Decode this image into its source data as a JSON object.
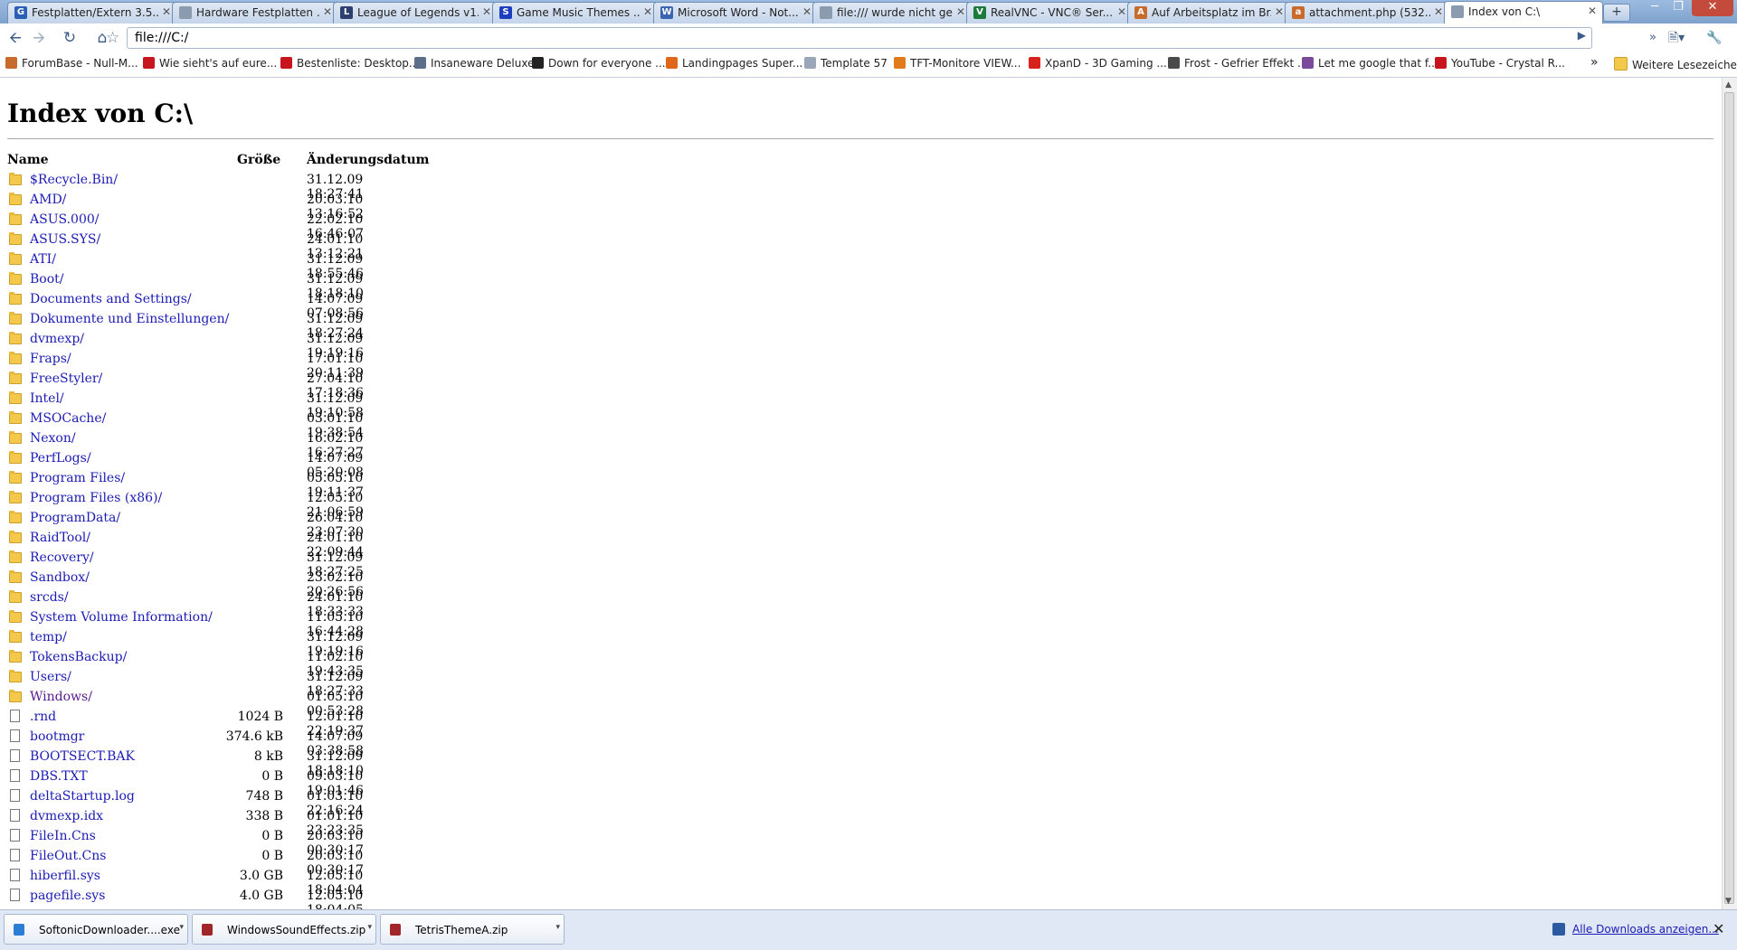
{
  "browser": {
    "tabs": [
      {
        "title": "Festplatten/Extern 3.5...",
        "icon": "g-icon",
        "color": "#2b5fb3",
        "glyph": "G"
      },
      {
        "title": "Hardware Festplatten ...",
        "icon": "page-icon",
        "color": "#8a9bb0",
        "glyph": ""
      },
      {
        "title": "League of Legends v1...",
        "icon": "lol-icon",
        "color": "#2c3f6e",
        "glyph": "L"
      },
      {
        "title": "Game Music Themes ...",
        "icon": "sonic-icon",
        "color": "#1c3fbf",
        "glyph": "S"
      },
      {
        "title": "Microsoft Word - Not...",
        "icon": "doc-icon",
        "color": "#3a64b0",
        "glyph": "W"
      },
      {
        "title": "file:/// wurde nicht ge...",
        "icon": "page-icon",
        "color": "#8a9bb0",
        "glyph": ""
      },
      {
        "title": "RealVNC - VNC® Ser...",
        "icon": "vnc-icon",
        "color": "#1d7a3a",
        "glyph": "V"
      },
      {
        "title": "Auf Arbeitsplatz im Br...",
        "icon": "forum-icon",
        "color": "#c86a2c",
        "glyph": "A"
      },
      {
        "title": "attachment.php (532...",
        "icon": "forum-icon",
        "color": "#c86a2c",
        "glyph": "a"
      },
      {
        "title": "Index von C:\\",
        "icon": "page-icon",
        "color": "#8a9bb0",
        "glyph": "",
        "active": true
      }
    ],
    "new_tab_label": "+",
    "url": "file:///C:/",
    "bookmarks": [
      {
        "label": "ForumBase - Null-M...",
        "icon": "forumbase-icon",
        "color": "#c86a2c"
      },
      {
        "label": "Wie sieht's auf eure...",
        "icon": "bookmark-red-icon",
        "color": "#c8141c"
      },
      {
        "label": "Bestenliste: Desktop...",
        "icon": "bookmark-red-icon",
        "color": "#c8141c"
      },
      {
        "label": "Insaneware Deluxe",
        "icon": "insaneware-icon",
        "color": "#5b6f8a"
      },
      {
        "label": "Down for everyone ...",
        "icon": "down-icon",
        "color": "#222222"
      },
      {
        "label": "Landingpages Super...",
        "icon": "landing-icon",
        "color": "#e0661a"
      },
      {
        "label": "Template 57",
        "icon": "page-icon",
        "color": "#9aa7b8"
      },
      {
        "label": "TFT-Monitore VIEW...",
        "icon": "tft-icon",
        "color": "#e07a1a"
      },
      {
        "label": "XpanD - 3D Gaming ...",
        "icon": "xpand-icon",
        "color": "#d8201c"
      },
      {
        "label": "Frost - Gefrier Effekt ...",
        "icon": "frost-icon",
        "color": "#4a4a4a"
      },
      {
        "label": "Let me google that f...",
        "icon": "lmgtfy-icon",
        "color": "#7b4a9a"
      },
      {
        "label": "YouTube - Crystal R...",
        "icon": "youtube-icon",
        "color": "#c8141c"
      }
    ],
    "bookmarks_overflow": "»",
    "other_bookmarks": "Weitere Lesezeichen"
  },
  "page": {
    "title": "Index von C:\\",
    "columns": {
      "name": "Name",
      "size": "Größe",
      "date": "Änderungsdatum"
    },
    "entries": [
      {
        "name": "$Recycle.Bin/",
        "size": "",
        "date": "31.12.09 18:27:41",
        "type": "folder"
      },
      {
        "name": "AMD/",
        "size": "",
        "date": "20.03.10 13:16:52",
        "type": "folder"
      },
      {
        "name": "ASUS.000/",
        "size": "",
        "date": "22.02.10 16:46:07",
        "type": "folder"
      },
      {
        "name": "ASUS.SYS/",
        "size": "",
        "date": "24.01.10 13:12:21",
        "type": "folder"
      },
      {
        "name": "ATI/",
        "size": "",
        "date": "31.12.09 18:55:46",
        "type": "folder"
      },
      {
        "name": "Boot/",
        "size": "",
        "date": "31.12.09 18:18:10",
        "type": "folder"
      },
      {
        "name": "Documents and Settings/",
        "size": "",
        "date": "14.07.09 07:08:56",
        "type": "folder"
      },
      {
        "name": "Dokumente und Einstellungen/",
        "size": "",
        "date": "31.12.09 18:27:24",
        "type": "folder"
      },
      {
        "name": "dvmexp/",
        "size": "",
        "date": "31.12.09 19:19:16",
        "type": "folder"
      },
      {
        "name": "Fraps/",
        "size": "",
        "date": "17.01.10 20:11:39",
        "type": "folder"
      },
      {
        "name": "FreeStyler/",
        "size": "",
        "date": "27.04.10 17:18:36",
        "type": "folder"
      },
      {
        "name": "Intel/",
        "size": "",
        "date": "31.12.09 19:10:58",
        "type": "folder"
      },
      {
        "name": "MSOCache/",
        "size": "",
        "date": "03.01.10 19:38:54",
        "type": "folder"
      },
      {
        "name": "Nexon/",
        "size": "",
        "date": "16.02.10 16:27:27",
        "type": "folder"
      },
      {
        "name": "PerfLogs/",
        "size": "",
        "date": "14.07.09 05:20:08",
        "type": "folder"
      },
      {
        "name": "Program Files/",
        "size": "",
        "date": "05.05.10 19:11:37",
        "type": "folder"
      },
      {
        "name": "Program Files (x86)/",
        "size": "",
        "date": "12.05.10 21:06:59",
        "type": "folder"
      },
      {
        "name": "ProgramData/",
        "size": "",
        "date": "26.04.10 23:07:30",
        "type": "folder"
      },
      {
        "name": "RaidTool/",
        "size": "",
        "date": "24.01.10 22:09:44",
        "type": "folder"
      },
      {
        "name": "Recovery/",
        "size": "",
        "date": "31.12.09 18:27:25",
        "type": "folder"
      },
      {
        "name": "Sandbox/",
        "size": "",
        "date": "23.02.10 20:26:56",
        "type": "folder"
      },
      {
        "name": "srcds/",
        "size": "",
        "date": "24.01.10 18:33:33",
        "type": "folder"
      },
      {
        "name": "System Volume Information/",
        "size": "",
        "date": "11.05.10 16:44:28",
        "type": "folder"
      },
      {
        "name": "temp/",
        "size": "",
        "date": "31.12.09 19:19:16",
        "type": "folder"
      },
      {
        "name": "TokensBackup/",
        "size": "",
        "date": "11.02.10 19:43:35",
        "type": "folder"
      },
      {
        "name": "Users/",
        "size": "",
        "date": "31.12.09 18:27:33",
        "type": "folder"
      },
      {
        "name": "Windows/",
        "size": "",
        "date": "01.05.10 00:53:28",
        "type": "folder",
        "visited": true
      },
      {
        "name": ".rnd",
        "size": "1024 B",
        "date": "12.01.10 22:19:37",
        "type": "file"
      },
      {
        "name": "bootmgr",
        "size": "374.6 kB",
        "date": "14.07.09 03:38:58",
        "type": "file"
      },
      {
        "name": "BOOTSECT.BAK",
        "size": "8 kB",
        "date": "31.12.09 18:18:10",
        "type": "file"
      },
      {
        "name": "DBS.TXT",
        "size": "0 B",
        "date": "09.03.10 19:01:46",
        "type": "file"
      },
      {
        "name": "deltaStartup.log",
        "size": "748 B",
        "date": "01.03.10 22:16:24",
        "type": "file"
      },
      {
        "name": "dvmexp.idx",
        "size": "338 B",
        "date": "01.01.10 23:23:35",
        "type": "file"
      },
      {
        "name": "FileIn.Cns",
        "size": "0 B",
        "date": "20.03.10 00:30:17",
        "type": "file"
      },
      {
        "name": "FileOut.Cns",
        "size": "0 B",
        "date": "20.03.10 00:30:17",
        "type": "file"
      },
      {
        "name": "hiberfil.sys",
        "size": "3.0 GB",
        "date": "12.05.10 18:04:04",
        "type": "file"
      },
      {
        "name": "pagefile.sys",
        "size": "4.0 GB",
        "date": "12.05.10 18:04:05",
        "type": "file"
      }
    ]
  },
  "downloads": {
    "items": [
      {
        "name": "SoftonicDownloader....exe",
        "icon": "exe-icon",
        "color": "#2a7fd4"
      },
      {
        "name": "WindowsSoundEffects.zip",
        "icon": "zip-icon",
        "color": "#a0262a"
      },
      {
        "name": "TetrisThemeA.zip",
        "icon": "zip-icon",
        "color": "#a0262a"
      }
    ],
    "show_all": "Alle Downloads anzeigen...",
    "close": "✕"
  }
}
